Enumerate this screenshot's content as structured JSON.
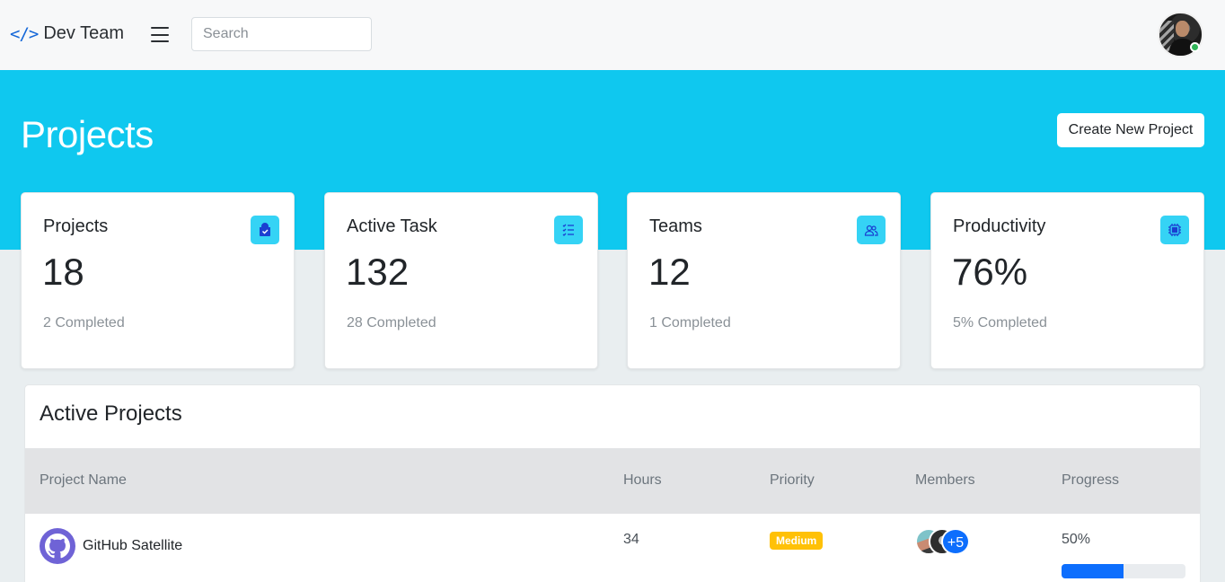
{
  "navbar": {
    "brand_icon": "</>",
    "brand_name": "Dev Team",
    "search_placeholder": "Search"
  },
  "hero": {
    "title": "Projects",
    "create_button": "Create New Project"
  },
  "stats": [
    {
      "title": "Projects",
      "value": "18",
      "sub": "2 Completed",
      "icon": "shopping-bag-icon"
    },
    {
      "title": "Active Task",
      "value": "132",
      "sub": "28 Completed",
      "icon": "task-list-icon"
    },
    {
      "title": "Teams",
      "value": "12",
      "sub": "1 Completed",
      "icon": "people-icon"
    },
    {
      "title": "Productivity",
      "value": "76%",
      "sub": "5% Completed",
      "icon": "cpu-icon"
    }
  ],
  "active_projects": {
    "title": "Active Projects",
    "columns": [
      "Project Name",
      "Hours",
      "Priority",
      "Members",
      "Progress"
    ],
    "rows": [
      {
        "name": "GitHub Satellite",
        "hours": "34",
        "priority": "Medium",
        "members_more": "+5",
        "progress_label": "50%",
        "progress": 0.5
      }
    ]
  },
  "colors": {
    "hero": "#0fc8ef",
    "accent": "#0d6efd",
    "priority_medium": "#ffc107",
    "icon_bg": "#35d3f5",
    "online": "#2fb457"
  }
}
